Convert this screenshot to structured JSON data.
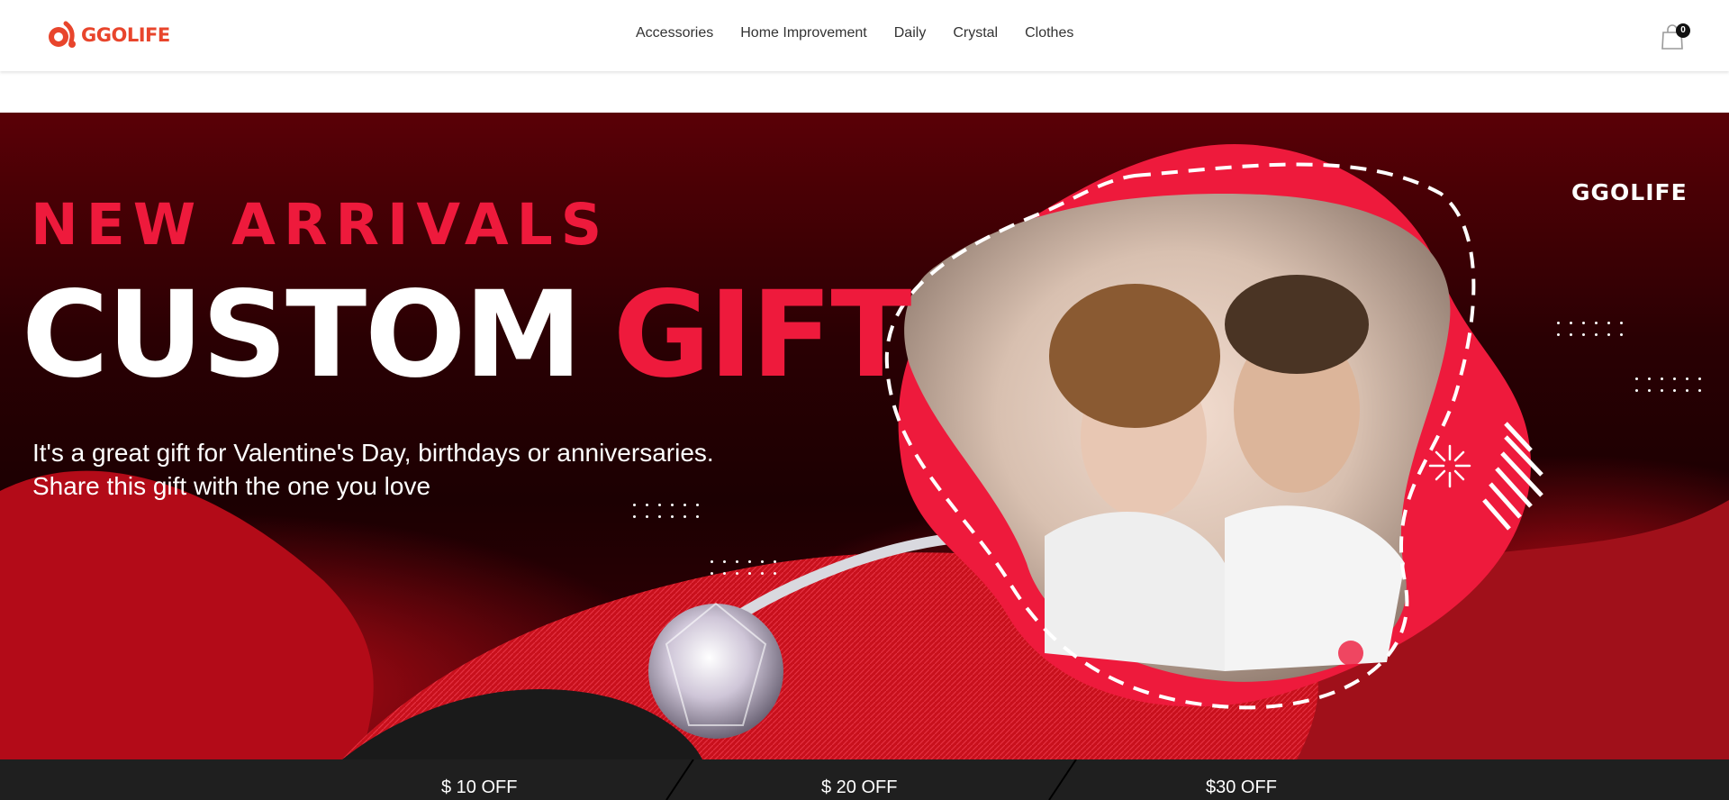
{
  "header": {
    "logo_text": "GGOLIFE",
    "nav": [
      {
        "label": "Accessories"
      },
      {
        "label": "Home Improvement"
      },
      {
        "label": "Daily"
      },
      {
        "label": "Crystal"
      },
      {
        "label": "Clothes"
      }
    ],
    "cart": {
      "icon": "shopping-bag-icon",
      "count": "0"
    }
  },
  "hero": {
    "eyebrow": "NEW ARRIVALS",
    "title_main": "CUSTOM",
    "title_accent": "GIFT",
    "description_line1": "It's a great gift for Valentine's Day, birthdays or anniversaries.",
    "description_line2": "Share this gift with the one you love",
    "brand_mark": "GGOLIFE",
    "colors": {
      "accent": "#ee1a3c",
      "background": "#1c0002",
      "text": "#ffffff"
    }
  },
  "coupons": [
    {
      "label": "$ 10 OFF"
    },
    {
      "label": "$ 20 OFF"
    },
    {
      "label": "$30 OFF"
    }
  ],
  "colors": {
    "brand": "#e8452c",
    "nav_text": "#333333",
    "coupon_bar": "#1f1f1f"
  }
}
